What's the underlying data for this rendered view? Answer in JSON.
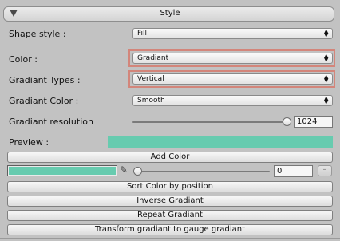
{
  "header": {
    "title": "Style"
  },
  "rows": {
    "shape_style": {
      "label": "Shape style :",
      "value": "Fill"
    },
    "color": {
      "label": "Color :",
      "value": "Gradiant"
    },
    "gradiant_types": {
      "label": "Gradiant Types :",
      "value": "Vertical"
    },
    "gradiant_color": {
      "label": "Gradiant Color :",
      "value": "Smooth"
    },
    "gradiant_resolution": {
      "label": "Gradiant resolution",
      "value": "1024",
      "slider_fraction": 1.0
    },
    "preview": {
      "label": "Preview :",
      "color": "#67cbaf"
    }
  },
  "buttons": {
    "add_color": "Add Color",
    "sort_color": "Sort Color by position",
    "inverse": "Inverse Gradiant",
    "repeat": "Repeat Gradiant",
    "transform": "Transform gradiant to gauge gradiant"
  },
  "color_key": {
    "color": "#67cbaf",
    "position_value": "0",
    "position_fraction": 0.0,
    "eyedropper_icon": "eyedropper-icon",
    "remove_label": "–"
  },
  "highlight_color": "#d3857a"
}
